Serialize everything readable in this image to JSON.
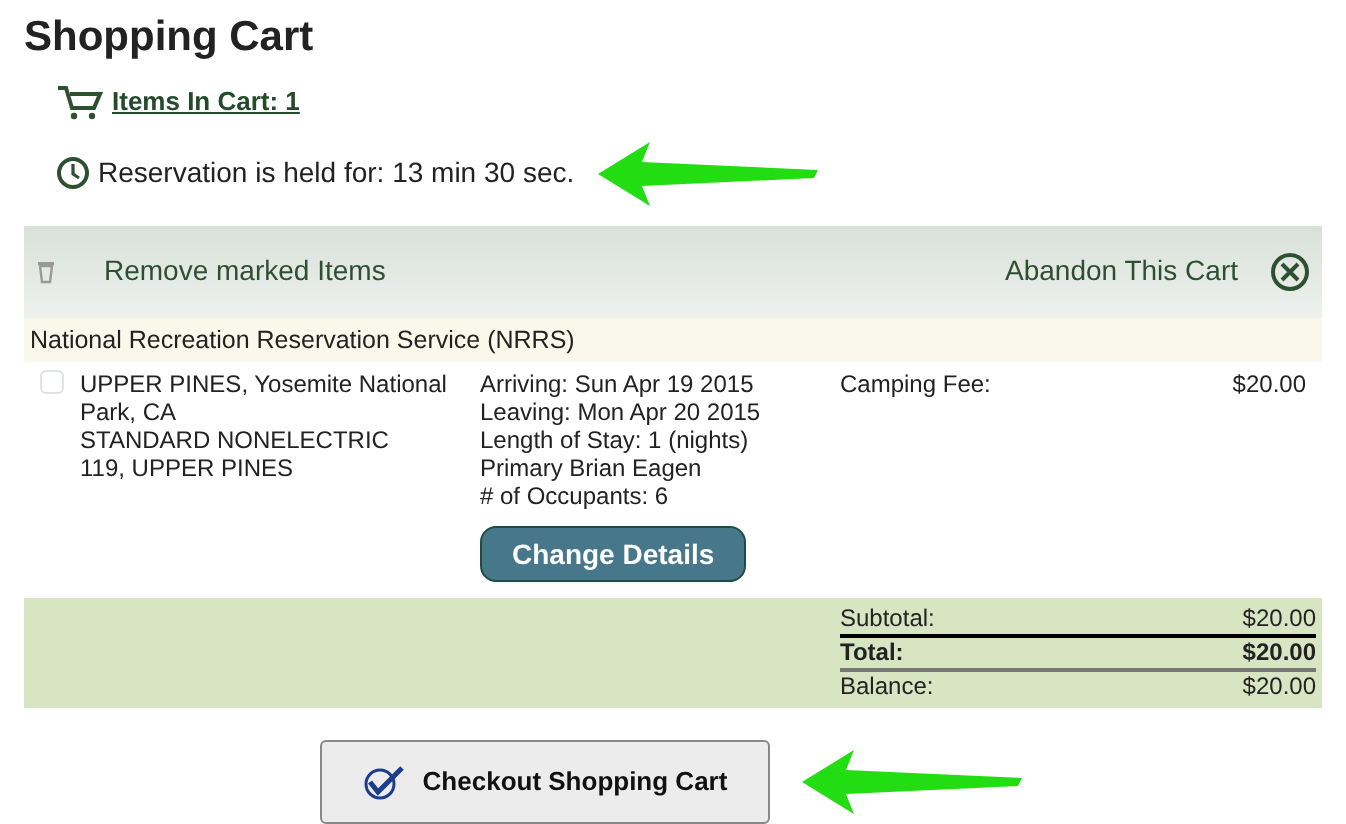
{
  "title": "Shopping Cart",
  "cart_link": "Items In Cart: 1",
  "reservation": "Reservation is held for: 13 min 30 sec.",
  "toolbar": {
    "remove": "Remove marked Items",
    "abandon": "Abandon This Cart"
  },
  "agency": "National Recreation Reservation Service (NRRS)",
  "items": [
    {
      "checked": false,
      "site_lines": [
        "UPPER PINES, Yosemite National Park, CA",
        "STANDARD NONELECTRIC",
        "119, UPPER PINES"
      ],
      "detail_lines": [
        "Arriving: Sun Apr 19 2015",
        "Leaving: Mon Apr 20 2015",
        "Length of Stay: 1 (nights)",
        "Primary Brian Eagen",
        "# of Occupants: 6"
      ],
      "button": "Change Details",
      "fee_label": "Camping Fee:",
      "fee": "$20.00"
    }
  ],
  "totals": [
    {
      "label": "Subtotal:",
      "value": "$20.00",
      "kind": "plain"
    },
    {
      "label": "Total:",
      "value": "$20.00",
      "kind": "total"
    },
    {
      "label": "Balance:",
      "value": "$20.00",
      "kind": "plain"
    }
  ],
  "checkout": "Checkout Shopping Cart"
}
